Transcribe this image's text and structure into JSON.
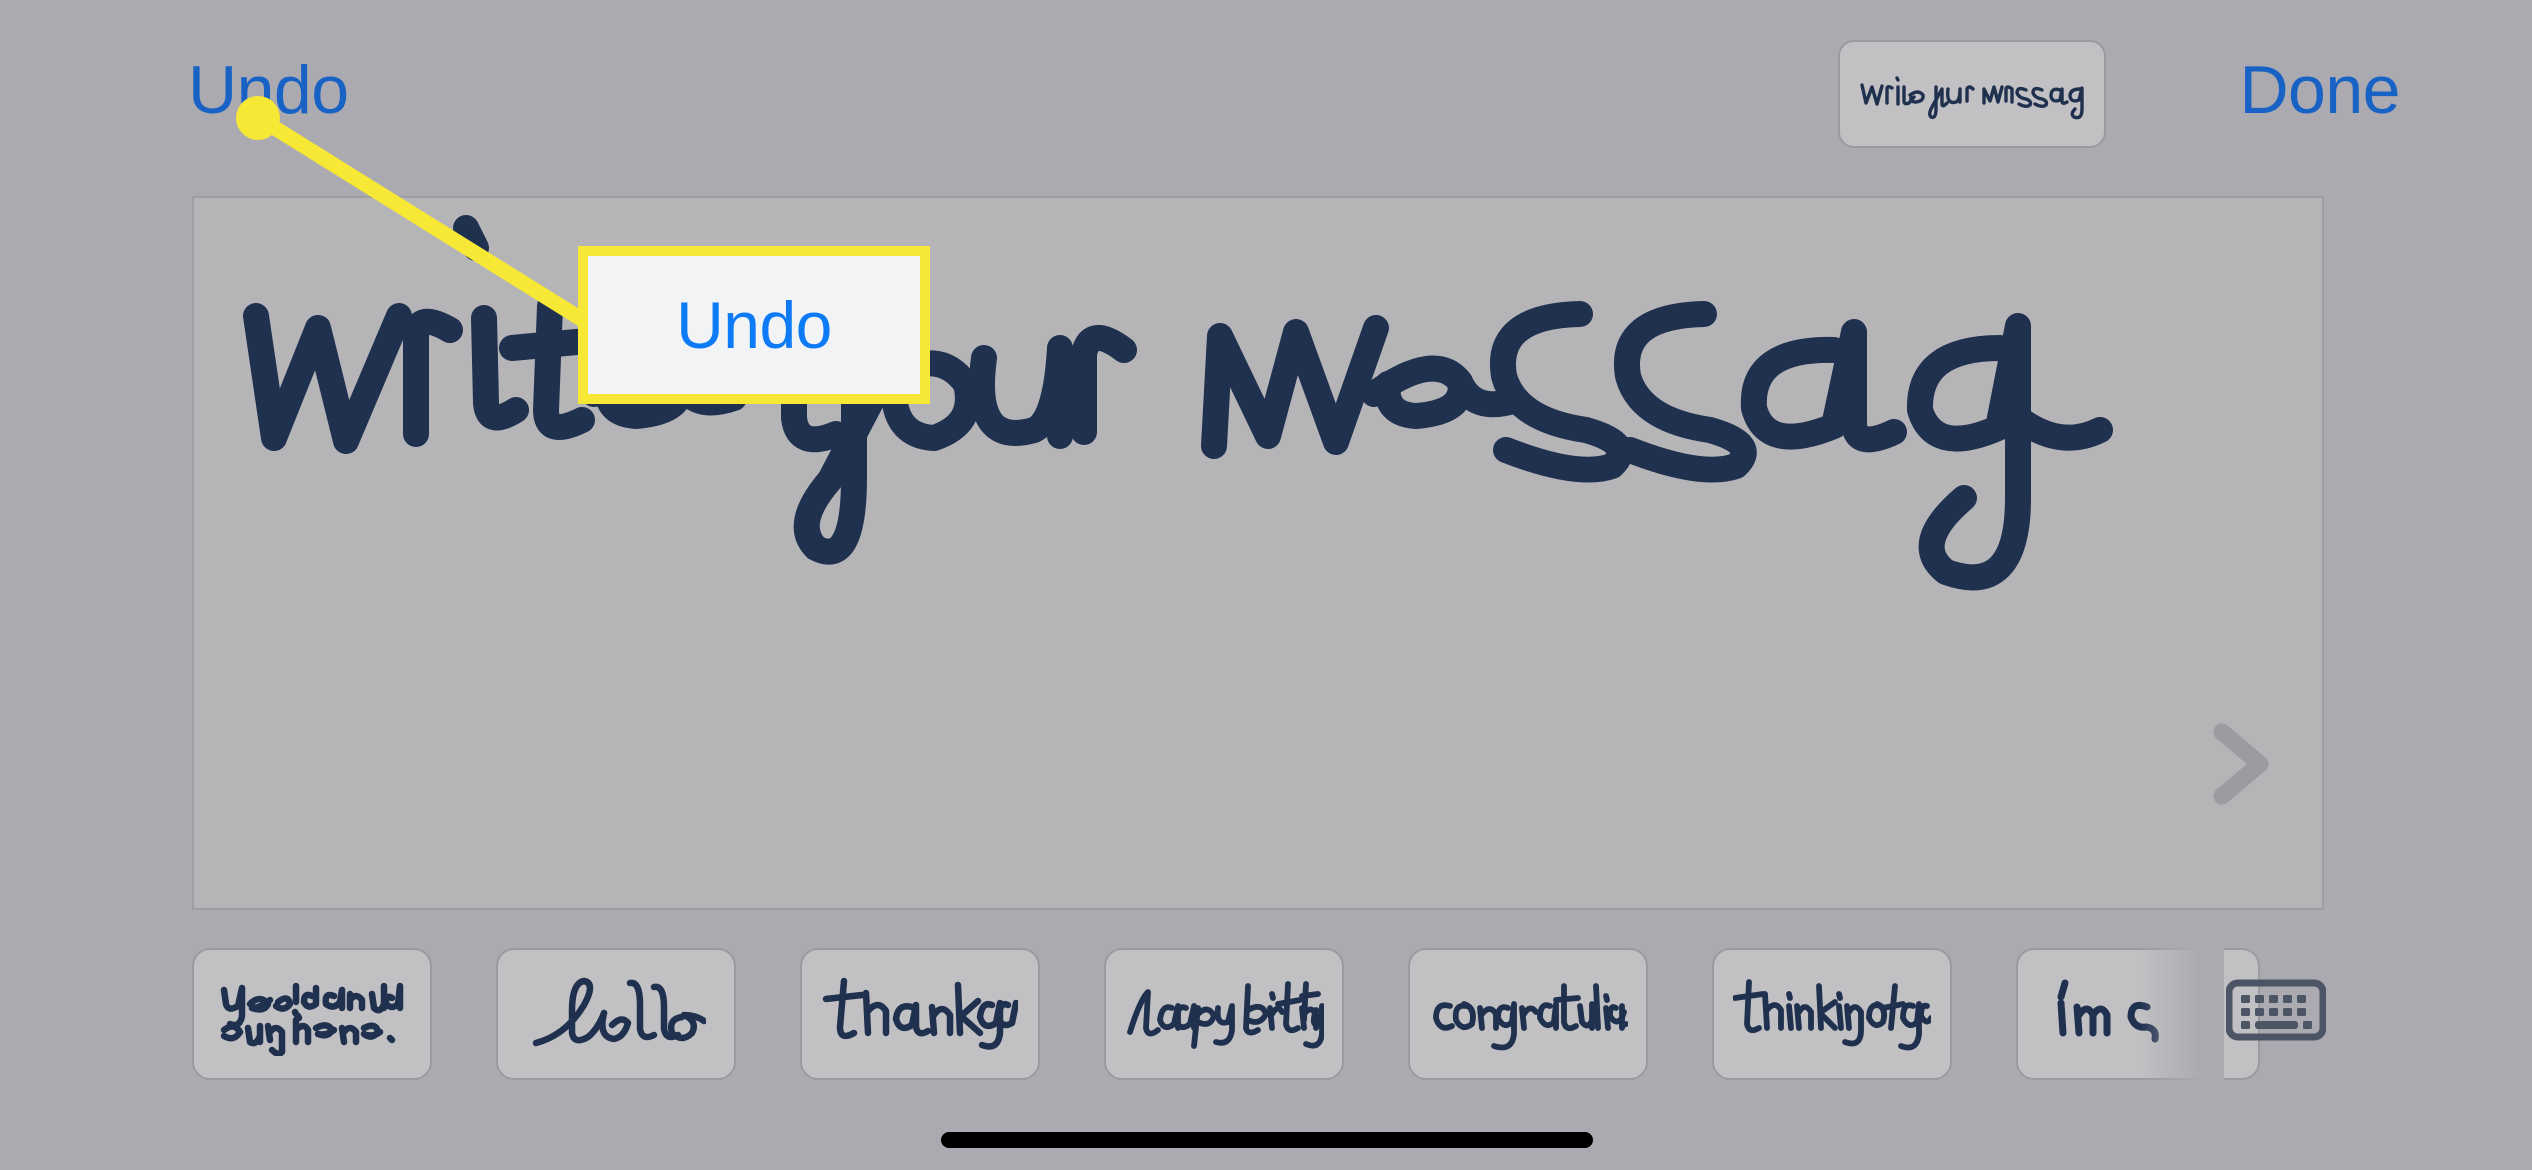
{
  "app": {
    "background_color": "#aaaab0",
    "accent_blue": "#1862c6",
    "ink_color": "#20304f",
    "highlight_yellow": "#f8e836"
  },
  "topbar": {
    "undo_label": "Undo",
    "done_label": "Done",
    "preview": {
      "name": "handwriting-preview-thumbnail",
      "handwritten_text": "write your message"
    }
  },
  "canvas": {
    "name": "handwriting-canvas",
    "handwritten_text": "write your message",
    "next_arrow_icon": "chevron-right-icon"
  },
  "suggestions": {
    "name": "handwriting-suggestion-strip",
    "items": [
      {
        "id": "sugg-yes-i-can-draw",
        "text": "yes! I can draw on my iPhone.",
        "truncated": false
      },
      {
        "id": "sugg-hello",
        "text": "hello",
        "truncated": false
      },
      {
        "id": "sugg-thank-you",
        "text": "thank you",
        "truncated": false
      },
      {
        "id": "sugg-happy-birthday",
        "text": "happy birthday",
        "truncated": false
      },
      {
        "id": "sugg-congratulations",
        "text": "congratulations",
        "truncated": false
      },
      {
        "id": "sugg-thinking-of-you",
        "text": "thinking of you",
        "truncated": false
      },
      {
        "id": "sugg-im-sorry",
        "text": "i'm s",
        "truncated": true
      }
    ],
    "keyboard_button_icon": "keyboard-icon"
  },
  "annotation": {
    "callout_label": "Undo",
    "callout_target": "undo-button",
    "marker_dot_color": "#f8e836",
    "leader_line_color": "#f8e836"
  },
  "system": {
    "home_indicator": "home-indicator-bar"
  }
}
